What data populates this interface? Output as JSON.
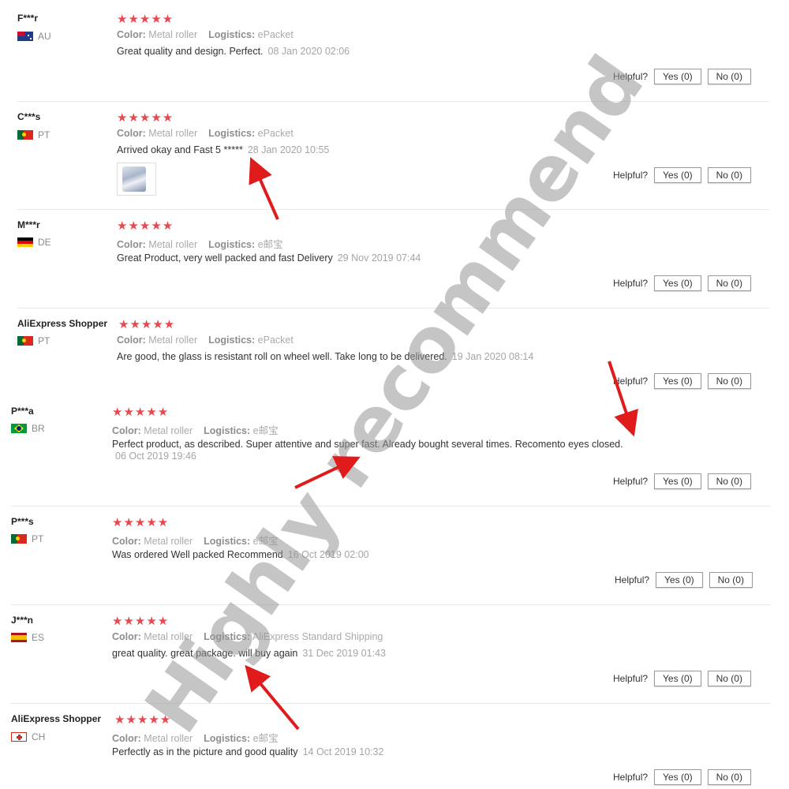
{
  "labels": {
    "color": "Color:",
    "logistics": "Logistics:",
    "helpful": "Helpful?",
    "yes": "Yes (0)",
    "no": "No (0)"
  },
  "reviews": [
    {
      "user": "F***r",
      "country": "AU",
      "flag": "au",
      "stars": "★★★★★",
      "color": "Metal roller",
      "logistics": "ePacket",
      "text": "Great quality and design. Perfect.",
      "date": "08 Jan 2020 02:06"
    },
    {
      "user": "C***s",
      "country": "PT",
      "flag": "pt",
      "stars": "★★★★★",
      "color": "Metal roller",
      "logistics": "ePacket",
      "text": "Arrived okay and Fast 5 *****",
      "date": "28 Jan 2020 10:55",
      "photo": "review-photo"
    },
    {
      "user": "M***r",
      "country": "DE",
      "flag": "de",
      "stars": "★★★★★",
      "color": "Metal roller",
      "logistics": "e邮宝",
      "text": "Great Product, very well packed and fast Delivery",
      "date": "29 Nov 2019 07:44"
    },
    {
      "user": "AliExpress Shopper",
      "country": "PT",
      "flag": "pt",
      "stars": "★★★★★",
      "color": "Metal roller",
      "logistics": "ePacket",
      "text": "Are good, the glass is resistant roll on wheel well. Take long to be delivered.",
      "date": "19 Jan 2020 08:14"
    },
    {
      "user": "P***a",
      "country": "BR",
      "flag": "br",
      "stars": "★★★★★",
      "color": "Metal roller",
      "logistics": "e邮宝",
      "text": "Perfect product, as described. Super attentive and super fast. Already bought several times. Recomento eyes closed.",
      "date": "06 Oct 2019 19:46"
    },
    {
      "user": "P***s",
      "country": "PT",
      "flag": "pt",
      "stars": "★★★★★",
      "color": "Metal roller",
      "logistics": "e邮宝",
      "text": "Was ordered Well packed Recommend",
      "date": "16 Oct 2019 02:00"
    },
    {
      "user": "J***n",
      "country": "ES",
      "flag": "es",
      "stars": "★★★★★",
      "color": "Metal roller",
      "logistics": "AliExpress Standard Shipping",
      "text": "great quality. great package. will buy again",
      "date": "31 Dec 2019 01:43"
    },
    {
      "user": "AliExpress Shopper",
      "country": "CH",
      "flag": "ch",
      "stars": "★★★★★",
      "color": "Metal roller",
      "logistics": "e邮宝",
      "text": "Perfectly as in the picture and good quality",
      "date": "14 Oct 2019 10:32"
    }
  ],
  "watermark": "Highly recommend",
  "colors": {
    "star": "#e8484f",
    "arrow": "#e01b1b",
    "watermark": "#969696"
  }
}
